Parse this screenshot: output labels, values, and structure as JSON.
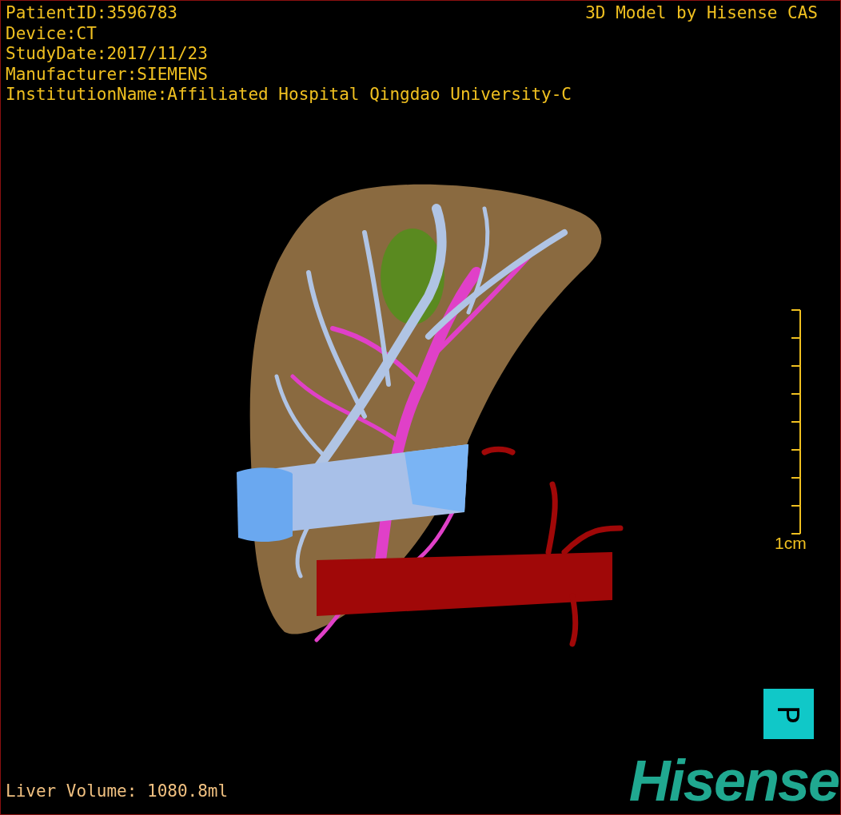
{
  "info_lines": [
    "PatientID:3596783",
    "Device:CT",
    "StudyDate:2017/11/23",
    "Manufacturer:SIEMENS",
    "InstitutionName:Affiliated Hospital Qingdao University-C"
  ],
  "caption": "3D Model by Hisense CAS",
  "scale_bar": {
    "label": "1cm"
  },
  "orientation_marker": {
    "label": "P"
  },
  "volume": "Liver Volume: 1080.8ml",
  "logo": {
    "text": "Hisense"
  }
}
